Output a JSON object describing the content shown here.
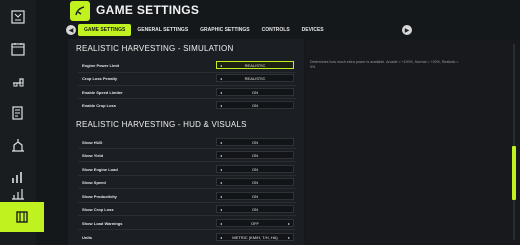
{
  "header": {
    "title": "GAME SETTINGS"
  },
  "tabs": [
    {
      "label": "GAME SETTINGS",
      "active": true
    },
    {
      "label": "GENERAL SETTINGS",
      "active": false
    },
    {
      "label": "GRAPHIC SETTINGS",
      "active": false
    },
    {
      "label": "CONTROLS",
      "active": false
    },
    {
      "label": "DEVICES",
      "active": false
    }
  ],
  "sidebar": {
    "items": [
      {
        "icon": "map-icon"
      },
      {
        "icon": "calendar-icon"
      },
      {
        "icon": "tractor-icon"
      },
      {
        "icon": "contracts-icon"
      },
      {
        "icon": "production-icon"
      },
      {
        "icon": "prices-icon"
      },
      {
        "icon": "statistics-icon"
      },
      {
        "icon": "settings-icon",
        "active": true
      }
    ]
  },
  "sections": [
    {
      "title": "REALISTIC HARVESTING - SIMULATION",
      "rows": [
        {
          "label": "Engine Power Limit",
          "value": "REALISTIC",
          "focused": true
        },
        {
          "label": "Crop Loss Penalty",
          "value": "REALISTIC"
        },
        {
          "label": "Enable Speed Limiter",
          "value": "ON"
        },
        {
          "label": "Enable Crop Loss",
          "value": "ON"
        }
      ]
    },
    {
      "title": "REALISTIC HARVESTING - HUD & VISUALS",
      "rows": [
        {
          "label": "Show HUD",
          "value": "ON"
        },
        {
          "label": "Show Yield",
          "value": "ON"
        },
        {
          "label": "Show Engine Load",
          "value": "ON"
        },
        {
          "label": "Show Speed",
          "value": "ON"
        },
        {
          "label": "Show Productivity",
          "value": "ON"
        },
        {
          "label": "Show Crop Loss",
          "value": "ON"
        },
        {
          "label": "Show Load Warnings",
          "value": "OFF"
        },
        {
          "label": "Units",
          "value": "METRIC (KM/H, T/H, HA)"
        }
      ]
    }
  ],
  "description": "Determines how much extra power is available. Arcade = +100%, Normal = +20%, Realistic = 0%",
  "colors": {
    "accent": "#bff21e",
    "background": "#15181b"
  }
}
